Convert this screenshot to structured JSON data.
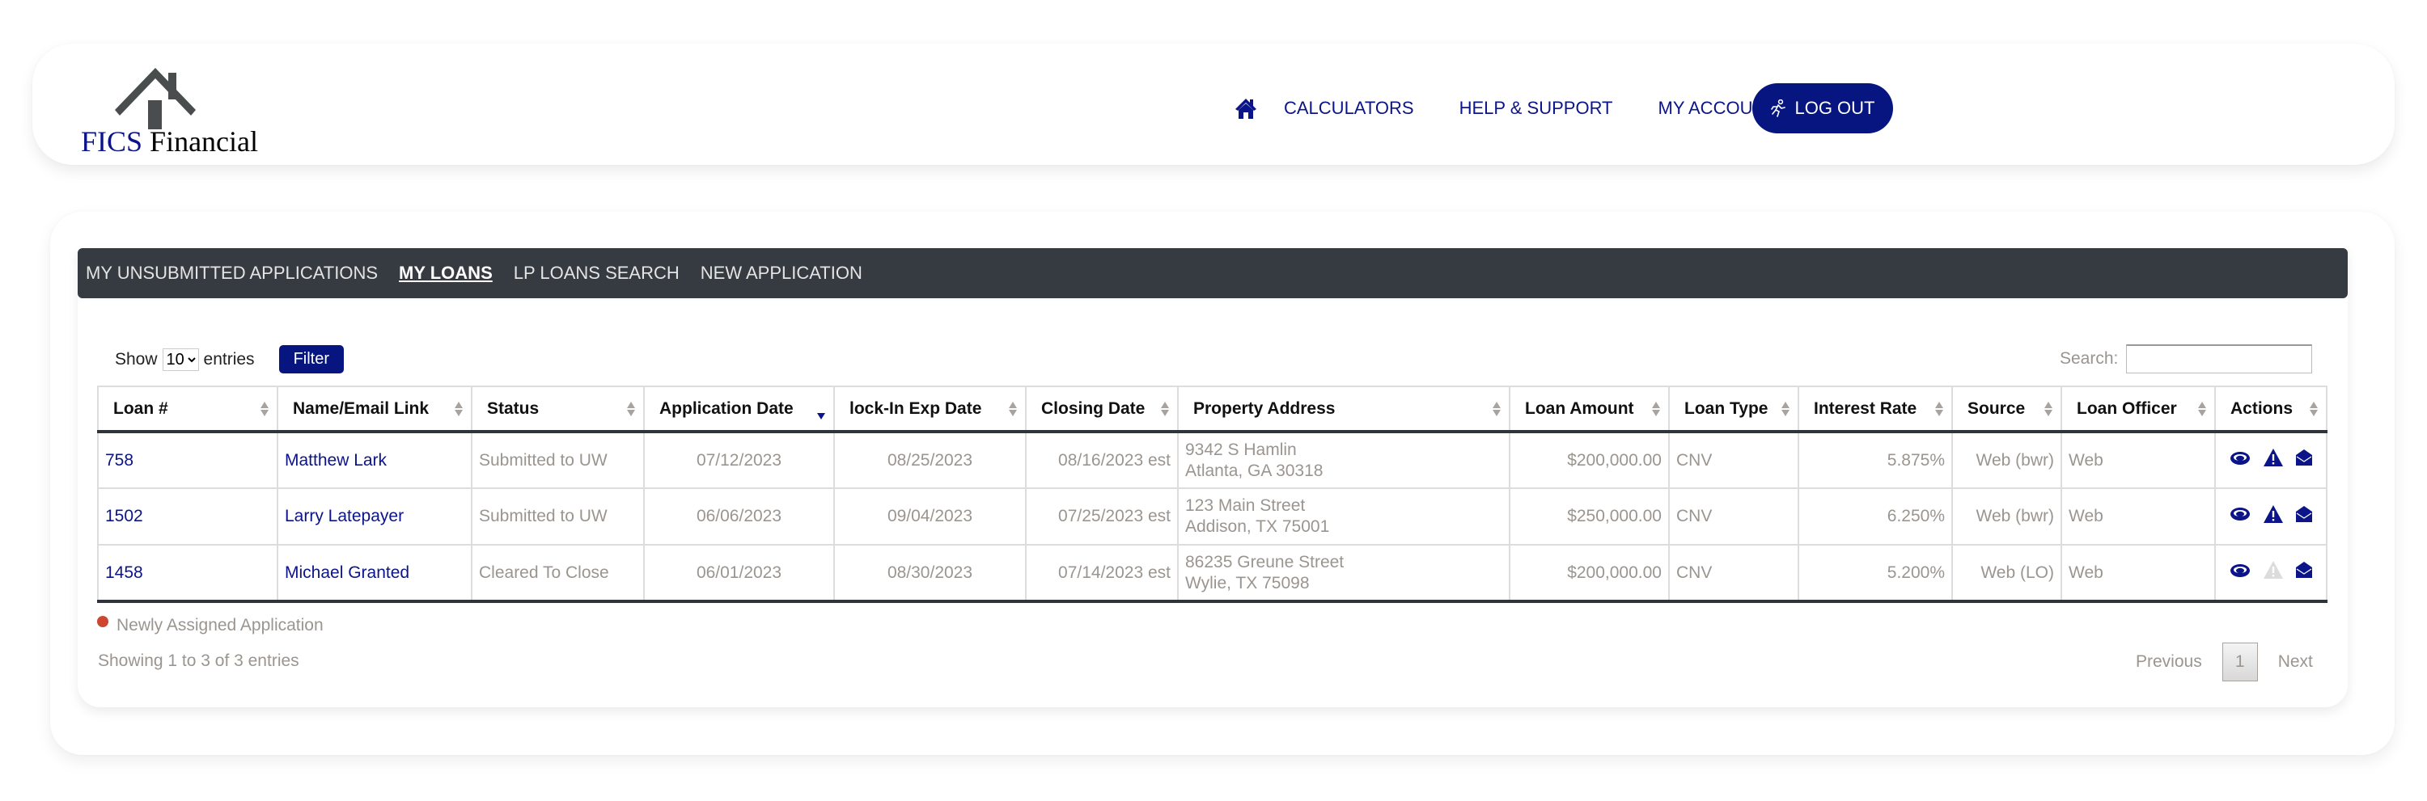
{
  "brand": {
    "name_part1": "FICS",
    "name_part2": " Financial",
    "accent_color": "#06157f"
  },
  "nav": {
    "home_icon": "home-icon",
    "items": [
      {
        "label": "CALCULATORS"
      },
      {
        "label": "HELP & SUPPORT"
      },
      {
        "label": "MY ACCOUNT",
        "has_dropdown": true
      }
    ],
    "logout_label": "LOG OUT",
    "logout_icon": "running-person-icon"
  },
  "subnav": {
    "items": [
      {
        "label": "MY UNSUBMITTED APPLICATIONS",
        "active": false
      },
      {
        "label": "MY LOANS",
        "active": true
      },
      {
        "label": "LP LOANS SEARCH",
        "active": false
      },
      {
        "label": "NEW APPLICATION",
        "active": false
      }
    ]
  },
  "controls": {
    "show_label": "Show",
    "entries_label": "entries",
    "page_size": "10",
    "page_size_options": [
      "10"
    ],
    "filter_label": "Filter",
    "search_label": "Search:",
    "search_value": ""
  },
  "table": {
    "columns": [
      {
        "label": "Loan #",
        "sort": "both"
      },
      {
        "label": "Name/Email Link",
        "sort": "both"
      },
      {
        "label": "Status",
        "sort": "both"
      },
      {
        "label": "Application Date",
        "sort": "desc"
      },
      {
        "label": "lock-In Exp Date",
        "sort": "both"
      },
      {
        "label": "Closing Date",
        "sort": "both"
      },
      {
        "label": "Property Address",
        "sort": "both"
      },
      {
        "label": "Loan Amount",
        "sort": "both"
      },
      {
        "label": "Loan Type",
        "sort": "both"
      },
      {
        "label": "Interest Rate",
        "sort": "both"
      },
      {
        "label": "Source",
        "sort": "both"
      },
      {
        "label": "Loan Officer",
        "sort": "both"
      },
      {
        "label": "Actions",
        "sort": "both"
      }
    ],
    "rows": [
      {
        "loan_no": "758",
        "name": "Matthew Lark",
        "status": "Submitted to UW",
        "app_date": "07/12/2023",
        "lock_exp": "08/25/2023",
        "closing": "08/16/2023 est",
        "address_line1": "9342 S Hamlin",
        "address_line2": "Atlanta, GA 30318",
        "amount": "$200,000.00",
        "loan_type": "CNV",
        "rate": "5.875%",
        "source": "Web (bwr)",
        "officer": "Web",
        "alert_enabled": true
      },
      {
        "loan_no": "1502",
        "name": "Larry Latepayer",
        "status": "Submitted to UW",
        "app_date": "06/06/2023",
        "lock_exp": "09/04/2023",
        "closing": "07/25/2023 est",
        "address_line1": "123 Main Street",
        "address_line2": "Addison, TX 75001",
        "amount": "$250,000.00",
        "loan_type": "CNV",
        "rate": "6.250%",
        "source": "Web (bwr)",
        "officer": "Web",
        "alert_enabled": true
      },
      {
        "loan_no": "1458",
        "name": "Michael Granted",
        "status": "Cleared To Close",
        "app_date": "06/01/2023",
        "lock_exp": "08/30/2023",
        "closing": "07/14/2023 est",
        "address_line1": "86235 Greune Street",
        "address_line2": "Wylie, TX 75098",
        "amount": "$200,000.00",
        "loan_type": "CNV",
        "rate": "5.200%",
        "source": "Web (LO)",
        "officer": "Web",
        "alert_enabled": false
      }
    ],
    "action_icons": [
      "eye-icon",
      "warning-icon",
      "envelope-open-icon"
    ]
  },
  "legend": {
    "label": "Newly Assigned Application",
    "color": "#cc4630"
  },
  "footer": {
    "info": "Showing 1 to 3 of 3 entries",
    "previous_label": "Previous",
    "current_page": "1",
    "next_label": "Next"
  }
}
